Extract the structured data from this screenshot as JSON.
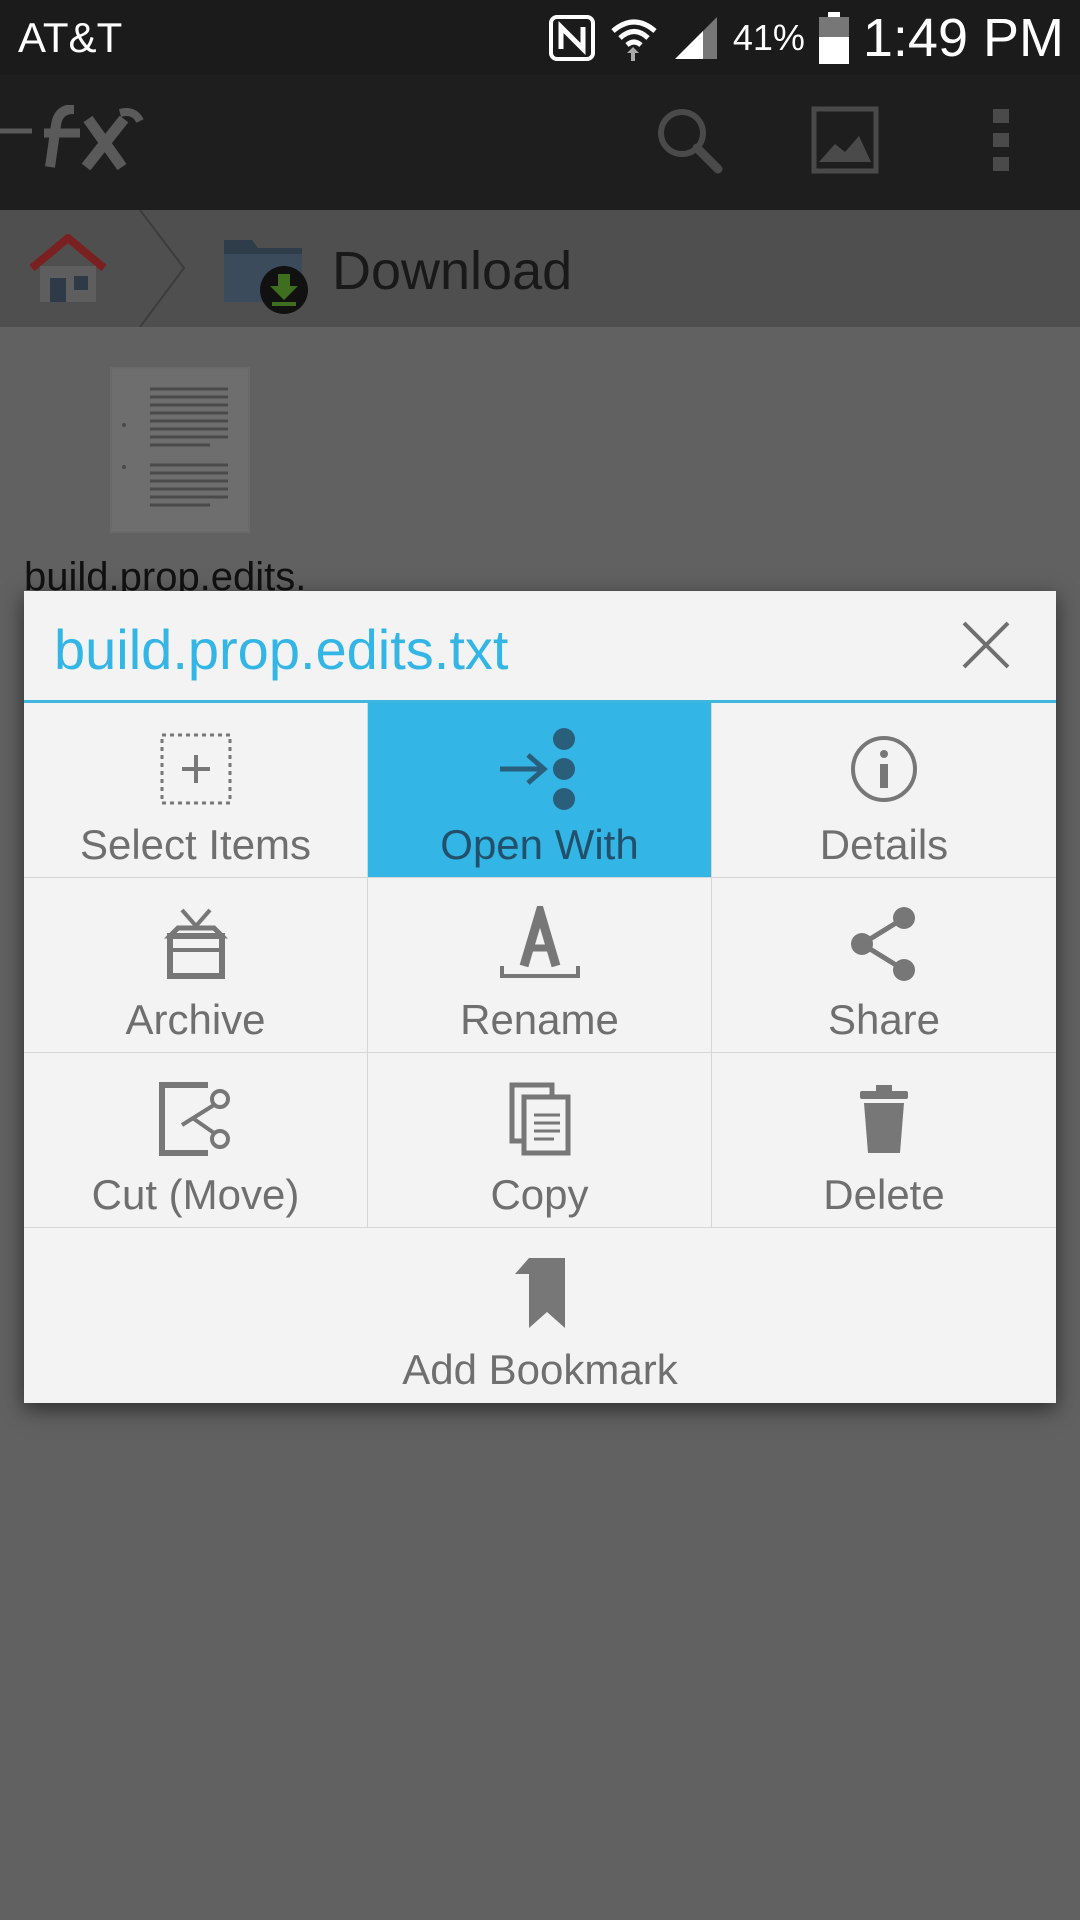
{
  "status_bar": {
    "carrier": "AT&T",
    "battery_percent": "41%",
    "time": "1:49 PM",
    "icons": [
      "nfc-icon",
      "wifi-icon",
      "signal-icon",
      "battery-icon"
    ]
  },
  "app_bar": {
    "icons": [
      "fx-logo-icon",
      "search-icon",
      "gallery-icon",
      "overflow-menu-icon"
    ]
  },
  "breadcrumb": {
    "current_folder": "Download"
  },
  "file_list": {
    "items": [
      {
        "name": "build.prop.edits."
      }
    ]
  },
  "dialog": {
    "title": "build.prop.edits.txt",
    "accent_color": "#33b5e5",
    "actions": [
      {
        "label": "Select Items",
        "icon": "select-items-icon"
      },
      {
        "label": "Open With",
        "icon": "open-with-icon",
        "selected": true
      },
      {
        "label": "Details",
        "icon": "info-icon"
      },
      {
        "label": "Archive",
        "icon": "archive-icon"
      },
      {
        "label": "Rename",
        "icon": "rename-icon"
      },
      {
        "label": "Share",
        "icon": "share-icon"
      },
      {
        "label": "Cut (Move)",
        "icon": "cut-icon"
      },
      {
        "label": "Copy",
        "icon": "copy-icon"
      },
      {
        "label": "Delete",
        "icon": "trash-icon"
      },
      {
        "label": "Add Bookmark",
        "icon": "bookmark-icon"
      }
    ]
  }
}
